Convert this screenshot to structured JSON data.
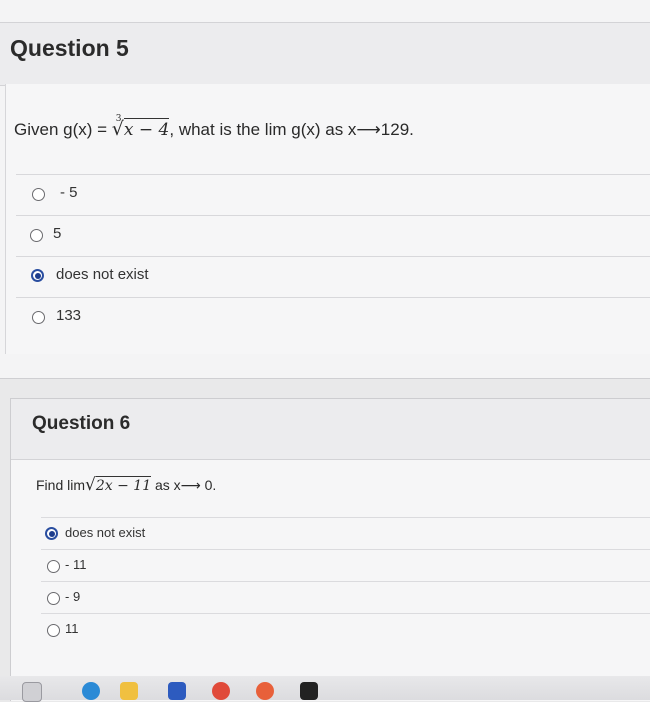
{
  "question5": {
    "title": "Question 5",
    "prompt_before": "Given g(x) = ",
    "root_index": "3",
    "radicand": "x − 4",
    "prompt_after": ", what is the lim g(x) as x⟶129.",
    "options": [
      {
        "label": "- 5",
        "selected": false
      },
      {
        "label": "5",
        "selected": false
      },
      {
        "label": "does not exist",
        "selected": true
      },
      {
        "label": "133",
        "selected": false
      }
    ]
  },
  "question6": {
    "title": "Question 6",
    "prompt_before": "Find lim",
    "radicand": "2x − 11",
    "prompt_after": " as x⟶ 0.",
    "options": [
      {
        "label": "does not exist",
        "selected": true
      },
      {
        "label": "- 11",
        "selected": false
      },
      {
        "label": "- 9",
        "selected": false
      },
      {
        "label": "11",
        "selected": false
      }
    ]
  },
  "colors": {
    "selected_radio": "#1c3c8c",
    "header_bg": "#ececee",
    "panel_bg": "#f6f6f7"
  },
  "dock": {
    "icons": [
      "calendar-icon",
      "edge-icon",
      "notes-icon",
      "teams-icon",
      "app-icon",
      "app-icon-2",
      "app-icon-3"
    ]
  }
}
